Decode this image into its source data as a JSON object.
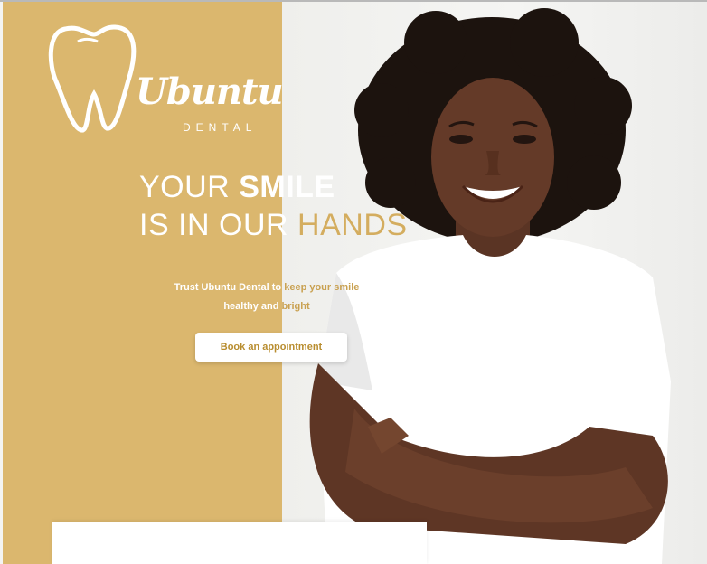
{
  "brand": {
    "logo_word": "Ubuntu",
    "logo_sub": "DENTAL"
  },
  "hero": {
    "headline_line1_a": "YOUR ",
    "headline_line1_b": "SMILE",
    "headline_line2_a": "IS IN OUR ",
    "headline_line2_b": "HANDS",
    "subtext_a": "Trust Ubuntu Dental to ",
    "subtext_b": "keep your smile",
    "subtext_c": "healthy and ",
    "subtext_d": "bright",
    "cta_label": "Book an appointment"
  },
  "colors": {
    "gold": "#dbb76e",
    "gold_text": "#d4ad5f",
    "button_text": "#b88d2f",
    "background": "#f4f4f2"
  },
  "icons": [
    "tooth-logo-icon"
  ]
}
